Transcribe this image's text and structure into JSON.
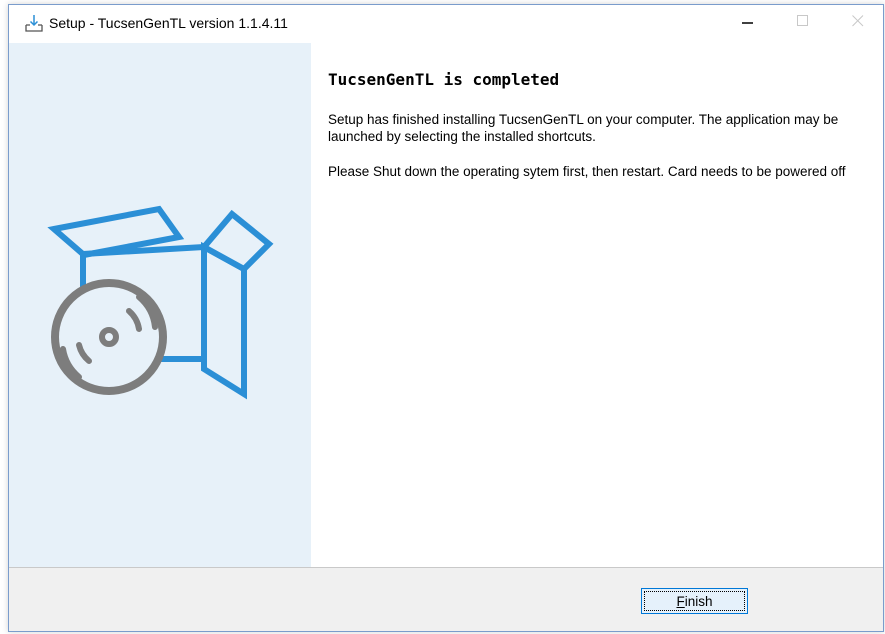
{
  "window": {
    "title": "Setup - TucsenGenTL version 1.1.4.11",
    "minimize_label": "–",
    "maximize_label": "□",
    "close_label": "✕"
  },
  "content": {
    "heading": "TucsenGenTL is completed",
    "paragraph1": "Setup has finished installing TucsenGenTL on your computer. The application may be launched by selecting the installed shortcuts.",
    "paragraph2": "Please Shut down the operating sytem first, then restart. Card needs to be powered off"
  },
  "footer": {
    "finish_mnemonic": "F",
    "finish_rest": "inish"
  },
  "colors": {
    "side_panel": "#e7f1f9",
    "box_blue": "#2b8fd6",
    "disc_gray": "#7d7d7d",
    "accent": "#0078d7"
  },
  "icons": {
    "title": "installer-download-icon",
    "art": "software-box-disc-icon"
  }
}
